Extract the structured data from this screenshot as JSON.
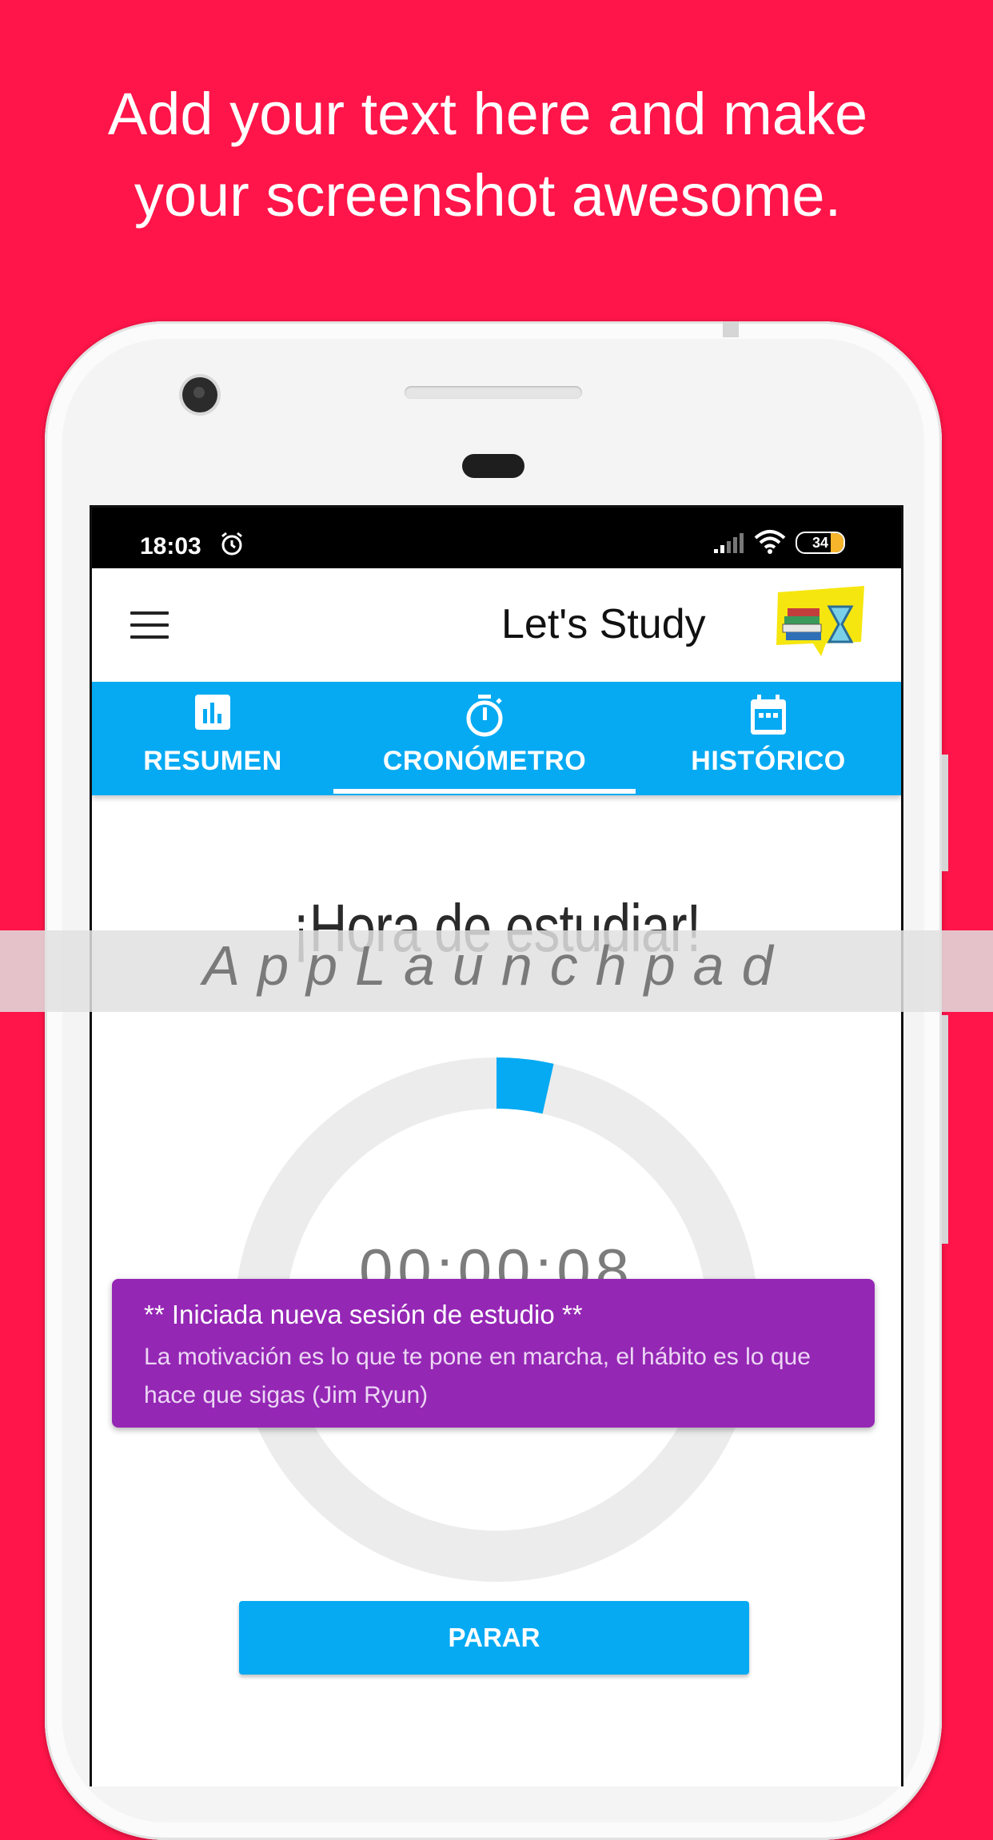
{
  "promo": {
    "line1": "Add your text here and make",
    "line2": "your screenshot awesome."
  },
  "status_bar": {
    "time": "18:03",
    "battery": "34"
  },
  "app_bar": {
    "title": "Let's Study"
  },
  "tabs": [
    {
      "label": "RESUMEN",
      "icon": "bar-chart-icon",
      "active": false
    },
    {
      "label": "CRONÓMETRO",
      "icon": "stopwatch-icon",
      "active": true
    },
    {
      "label": "HISTÓRICO",
      "icon": "calendar-icon",
      "active": false
    }
  ],
  "main": {
    "heading": "¡Hora de estudiar!",
    "timer": "00:00:08",
    "progress": 0.035,
    "button_label": "PARAR"
  },
  "toast": {
    "title": "** Iniciada nueva sesión de estudio **",
    "message": "La motivación es lo que te pone en marcha, el hábito es lo que hace que sigas (Jim Ryun)"
  },
  "watermark": "AppLaunchpad",
  "colors": {
    "background": "#ff1549",
    "accent": "#05aaf3",
    "toast": "#9527b5"
  }
}
